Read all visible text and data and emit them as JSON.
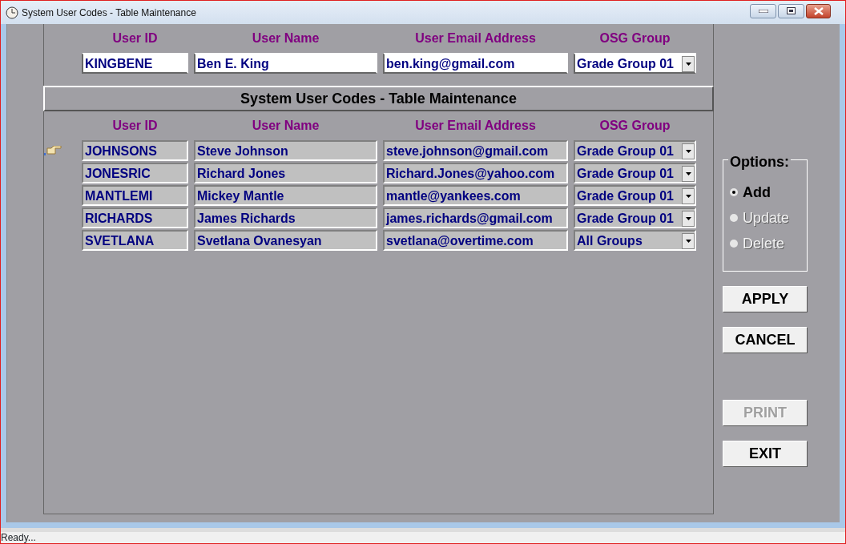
{
  "window": {
    "title": "System User Codes - Table Maintenance"
  },
  "editor": {
    "columns": [
      "User ID",
      "User Name",
      "User Email Address",
      "OSG Group"
    ],
    "user_id": "KINGBENE",
    "user_name": "Ben E. King",
    "email": "ben.king@gmail.com",
    "osg_group": "Grade Group 01"
  },
  "section_title": "System User Codes - Table Maintenance",
  "table": {
    "columns": [
      "User ID",
      "User Name",
      "User Email Address",
      "OSG Group"
    ],
    "rows": [
      {
        "user_id": "JOHNSONS",
        "user_name": "Steve Johnson",
        "email": "steve.johnson@gmail.com",
        "osg_group": "Grade Group 01",
        "current": true
      },
      {
        "user_id": "JONESRIC",
        "user_name": "Richard Jones",
        "email": "Richard.Jones@yahoo.com",
        "osg_group": "Grade Group 01",
        "current": false
      },
      {
        "user_id": "MANTLEMI",
        "user_name": "Mickey Mantle",
        "email": "mantle@yankees.com",
        "osg_group": "Grade Group 01",
        "current": false
      },
      {
        "user_id": "RICHARDS",
        "user_name": "James Richards",
        "email": "james.richards@gmail.com",
        "osg_group": "Grade Group 01",
        "current": false
      },
      {
        "user_id": "SVETLANA",
        "user_name": "Svetlana Ovanesyan",
        "email": "svetlana@overtime.com",
        "osg_group": "All Groups",
        "current": false
      }
    ]
  },
  "options": {
    "title": "Options:",
    "items": [
      {
        "label": "Add",
        "selected": true,
        "disabled": false
      },
      {
        "label": "Update",
        "selected": false,
        "disabled": true
      },
      {
        "label": "Delete",
        "selected": false,
        "disabled": true
      }
    ]
  },
  "action_buttons": [
    {
      "label": "APPLY",
      "disabled": false
    },
    {
      "label": "CANCEL",
      "disabled": false
    }
  ],
  "other_buttons": [
    {
      "label": "PRINT",
      "disabled": true
    },
    {
      "label": "EXIT",
      "disabled": false
    }
  ],
  "status_bar": "Ready..."
}
